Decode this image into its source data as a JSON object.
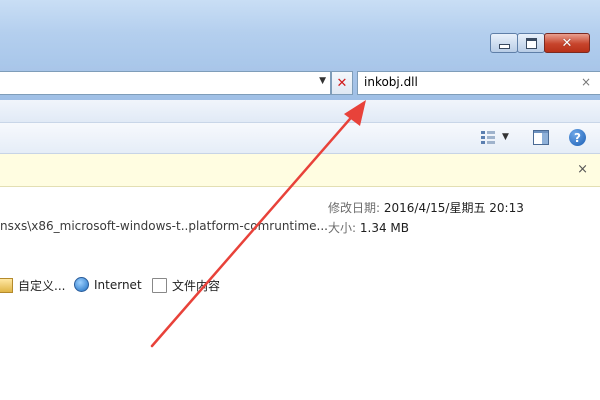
{
  "window": {
    "caption_buttons": [
      "minimize-icon",
      "maximize-icon",
      "close-icon"
    ],
    "close_glyph": "✕"
  },
  "address_bar": {
    "dropdown_glyph": "▼",
    "stop_glyph": "✕"
  },
  "search_box": {
    "value": "inkobj.dll",
    "clear_glyph": "×"
  },
  "command_bar": {
    "icons": [
      "views-icon",
      "preview-pane-icon",
      "help-icon"
    ],
    "views_dropdown_glyph": "▼",
    "help_glyph": "?"
  },
  "info_bar": {
    "close_glyph": "×"
  },
  "result": {
    "path": "nsxs\\x86_microsoft-windows-t..platform-comruntime...",
    "modified_label": "修改日期:",
    "modified_value": "2016/4/15/星期五 20:13",
    "size_label": "大小:",
    "size_value": "1.34 MB"
  },
  "search_again": {
    "custom": "自定义...",
    "internet": "Internet",
    "file_contents": "文件内容"
  },
  "colors": {
    "annotation_arrow": "#e8423a",
    "accent_blue": "#1b5fb5"
  }
}
